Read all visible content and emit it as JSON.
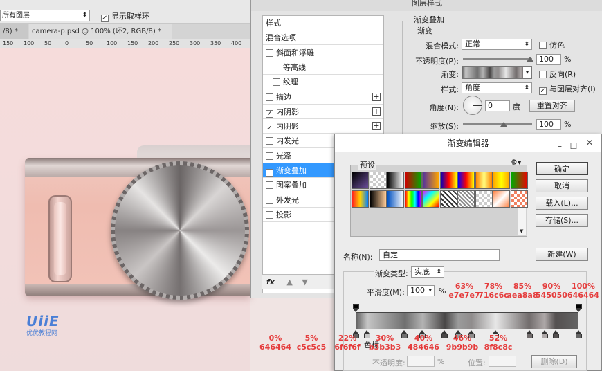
{
  "options_bar": {
    "layer_select": "所有图层",
    "sample_ring_label": "显示取样环"
  },
  "tabs": [
    {
      "label": "/8) *"
    },
    {
      "label": "camera-p.psd @ 100% (环2, RGB/8) *"
    }
  ],
  "ruler": {
    "ticks": [
      "150",
      "100",
      "50",
      "0",
      "50",
      "100",
      "150",
      "200",
      "250",
      "300",
      "350",
      "400"
    ]
  },
  "watermark": {
    "logo": "UiiE",
    "sub": "优优教程网"
  },
  "layer_style": {
    "title": "图层样式",
    "list": [
      {
        "label": "样式",
        "checkbox": false,
        "plus": false,
        "indent": false,
        "checked": false,
        "selected": false
      },
      {
        "label": "混合选项",
        "checkbox": false,
        "plus": false,
        "indent": false,
        "checked": false,
        "selected": false
      },
      {
        "label": "斜面和浮雕",
        "checkbox": true,
        "plus": false,
        "indent": false,
        "checked": false,
        "selected": false
      },
      {
        "label": "等高线",
        "checkbox": true,
        "plus": false,
        "indent": true,
        "checked": false,
        "selected": false
      },
      {
        "label": "纹理",
        "checkbox": true,
        "plus": false,
        "indent": true,
        "checked": false,
        "selected": false
      },
      {
        "label": "描边",
        "checkbox": true,
        "plus": true,
        "indent": false,
        "checked": false,
        "selected": false
      },
      {
        "label": "内阴影",
        "checkbox": true,
        "plus": true,
        "indent": false,
        "checked": true,
        "selected": false
      },
      {
        "label": "内阴影",
        "checkbox": true,
        "plus": true,
        "indent": false,
        "checked": true,
        "selected": false
      },
      {
        "label": "内发光",
        "checkbox": true,
        "plus": false,
        "indent": false,
        "checked": false,
        "selected": false
      },
      {
        "label": "光泽",
        "checkbox": true,
        "plus": false,
        "indent": false,
        "checked": false,
        "selected": false
      },
      {
        "label": "渐变叠加",
        "checkbox": true,
        "plus": false,
        "indent": false,
        "checked": true,
        "selected": true
      },
      {
        "label": "图案叠加",
        "checkbox": true,
        "plus": false,
        "indent": false,
        "checked": false,
        "selected": false
      },
      {
        "label": "外发光",
        "checkbox": true,
        "plus": false,
        "indent": false,
        "checked": false,
        "selected": false
      },
      {
        "label": "投影",
        "checkbox": true,
        "plus": false,
        "indent": false,
        "checked": false,
        "selected": false
      }
    ],
    "fx_label": "fx",
    "overlay": {
      "heading": "渐变叠加",
      "sub": "渐变",
      "blend_label": "混合模式:",
      "blend_value": "正常",
      "dither_label": "仿色",
      "opacity_label": "不透明度(P):",
      "opacity_value": "100",
      "opacity_unit": "%",
      "gradient_label": "渐变:",
      "reverse_label": "反向(R)",
      "style_label": "样式:",
      "style_value": "角度",
      "align_label": "与图层对齐(I)",
      "angle_label": "角度(N):",
      "angle_value": "0",
      "angle_unit": "度",
      "reset_button": "重置对齐",
      "scale_label": "缩放(S):",
      "scale_value": "100",
      "scale_unit": "%"
    }
  },
  "gradient_editor": {
    "title": "渐变编辑器",
    "presets_label": "预设",
    "gear_icon": "gear-icon",
    "buttons": {
      "ok": "确定",
      "cancel": "取消",
      "load": "载入(L)...",
      "save": "存储(S)...",
      "new": "新建(W)"
    },
    "name_label": "名称(N):",
    "name_value": "自定",
    "type_label": "渐变类型:",
    "type_value": "实底",
    "smooth_label": "平滑度(M):",
    "smooth_value": "100",
    "smooth_unit": "%",
    "color_label": "色标",
    "stop_opacity_label": "不透明度:",
    "stop_opacity_unit": "%",
    "position_label": "位置:",
    "delete_button": "删除(D)",
    "presets": [
      [
        "#000000",
        "#ffffff",
        "#000000",
        "#ff0000",
        "#ffd000",
        "#0000ff",
        "#ff0000",
        "#ff8c00",
        "#ffa500",
        "#0a9030"
      ],
      [
        "#ff3030",
        "#ffffff",
        "#e0e0e0",
        "#ff00ff",
        "#ffdd00",
        "#c0c0c0",
        "#8aa0b0",
        "#ffffff",
        "#ffb070",
        "#f08060"
      ]
    ],
    "stops_top_pct": [
      0,
      100
    ],
    "stops_bottom_pct": [
      0,
      5,
      22,
      30,
      40,
      46,
      52,
      63,
      78,
      85,
      90,
      100
    ],
    "stop_colors": [
      "#646464",
      "#c5c5c5",
      "#6f6f6f",
      "#b3b3b3",
      "#484646",
      "#9b9b9b",
      "#8f8c8c",
      "#e7e7e7",
      "#716c6c",
      "#aea8a8",
      "#545050",
      "#646464"
    ]
  },
  "annotations_upper": [
    {
      "pct": "63%",
      "hex": "e7e7e7"
    },
    {
      "pct": "78%",
      "hex": "716c6c"
    },
    {
      "pct": "85%",
      "hex": "aea8a8"
    },
    {
      "pct": "90%",
      "hex": "545050"
    },
    {
      "pct": "100%",
      "hex": "646464"
    }
  ],
  "annotations_lower": [
    {
      "pct": "0%",
      "hex": "646464"
    },
    {
      "pct": "5%",
      "hex": "c5c5c5"
    },
    {
      "pct": "22%",
      "hex": "6f6f6f"
    },
    {
      "pct": "30%",
      "hex": "b3b3b3"
    },
    {
      "pct": "40%",
      "hex": "484646"
    },
    {
      "pct": "46%",
      "hex": "9b9b9b"
    },
    {
      "pct": "52%",
      "hex": "8f8c8c"
    }
  ]
}
